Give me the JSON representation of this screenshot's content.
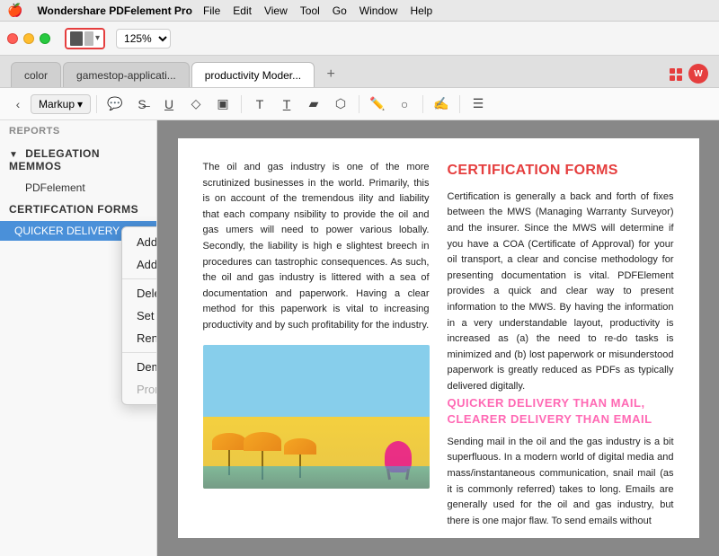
{
  "menubar": {
    "apple": "🍎",
    "appname": "Wondershare PDFelement Pro",
    "items": [
      "File",
      "Edit",
      "View",
      "Tool",
      "Go",
      "Window",
      "Help"
    ]
  },
  "toolbar": {
    "zoom": "125%",
    "panel_toggle_label": "panel toggle"
  },
  "tabs": [
    {
      "id": "color",
      "label": "color",
      "active": false
    },
    {
      "id": "gamestop",
      "label": "gamestop-applicati...",
      "active": false
    },
    {
      "id": "productivity",
      "label": "productivity Moder...",
      "active": true
    }
  ],
  "markup_toolbar": {
    "nav_back": "‹",
    "nav_fwd": "›",
    "markup_label": "Markup",
    "tools": [
      "comment",
      "strikethrough",
      "underline",
      "highlight-erase",
      "highlight",
      "text",
      "text-box",
      "redact",
      "stamp",
      "pen",
      "shapes",
      "signature",
      "pan"
    ]
  },
  "sidebar": {
    "sections": [
      {
        "id": "reports",
        "label": "REPORTS",
        "expanded": false,
        "items": []
      },
      {
        "id": "delegation",
        "label": "DELEGATION MEMMOS",
        "expanded": true,
        "items": [
          {
            "id": "pdfelement",
            "label": "PDFelement"
          }
        ]
      },
      {
        "id": "certif",
        "label": "CERTIFCATION FORMS",
        "expanded": false,
        "items": []
      },
      {
        "id": "quicker",
        "label": "QUICKER DELIVERY",
        "active": true,
        "items": []
      }
    ]
  },
  "context_menu": {
    "items": [
      {
        "id": "add-entry",
        "label": "Add Entry",
        "disabled": false
      },
      {
        "id": "add-child",
        "label": "Add Child",
        "disabled": false
      },
      {
        "id": "sep1",
        "type": "separator"
      },
      {
        "id": "delete-bookmark",
        "label": "Delete Bookmark",
        "disabled": false
      },
      {
        "id": "set-destination",
        "label": "Set Destination",
        "disabled": false
      },
      {
        "id": "rename-bookmark",
        "label": "Rename Bookmark",
        "disabled": false
      },
      {
        "id": "sep2",
        "type": "separator"
      },
      {
        "id": "demote",
        "label": "Demote",
        "disabled": false
      },
      {
        "id": "promote",
        "label": "Promote",
        "disabled": true
      }
    ]
  },
  "pdf": {
    "left_text_1": "The oil and gas industry is one of the more scrutinized businesses in the world. Primarily, this is on account of the tremendous",
    "left_text_2": "ility and liability that each company",
    "left_text_3": "nsibility to provide the oil and gas",
    "left_text_4": "umers will need to power various",
    "left_text_5": "lobally. Secondly, the liability is high",
    "left_text_6": "e slightest breech in procedures can",
    "left_text_7": "tastrophic consequences. As such, the oil and gas industry is littered with a sea of documentation and paperwork. Having a clear method for this paperwork is vital to increasing productivity and by such profitability for the industry.",
    "left_para": "The oil and gas industry is one of the more scrutinized businesses in the world. Primarily, this is on account of the tremendous ility and liability that each company nsibility to provide the oil and gas umers will need to power various lobally. Secondly, the liability is high e slightest breech in procedures can tastrophic consequences. As such, the oil and gas industry is littered with a sea of documentation and paperwork. Having a clear method for this paperwork is vital to increasing productivity and by such profitability for the industry.",
    "right_heading": "CERTIFICATION FORMS",
    "right_para1": "Certification is generally a back and forth of fixes between the MWS (Managing Warranty Surveyor) and the insurer. Since the MWS will determine if you have a COA (Certificate of Approval) for your oil transport, a clear and concise methodology for presenting documentation is vital. PDFElement provides a quick and clear way to present information to the MWS. By having the information in a very understandable layout, productivity is increased as (a) the need to re-do tasks is minimized and (b) lost paperwork or misunderstood paperwork is greatly reduced as PDFs as typically delivered digitally.",
    "right_subheading": "QUICKER DELIVERY THAN MAIL, CLEARER DELIVERY THAN EMAIL",
    "right_para2": "Sending mail in the oil and the gas industry is a bit superfluous. In a modern world of digital media and mass/instantaneous communication, snail mail (as it is commonly referred) takes to long. Emails are generally used for the oil and gas industry, but there is one major flaw. To send emails without"
  }
}
